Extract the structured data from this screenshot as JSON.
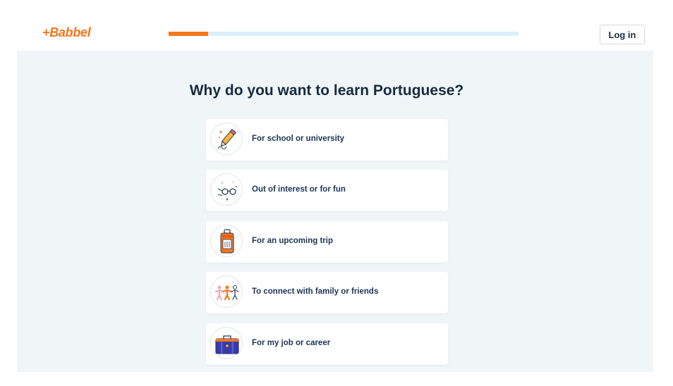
{
  "header": {
    "logo_text": "+Babbel",
    "login_label": "Log in",
    "progress_fraction": 0.113
  },
  "colors": {
    "brand_orange": "#f3761c",
    "progress_track": "#d8eefc",
    "text_dark": "#162b41",
    "panel_bg": "#f0f5f8"
  },
  "main": {
    "question": "Why do you want to learn Portuguese?",
    "options": [
      {
        "label": "For school or university",
        "icon": "pencil-icon"
      },
      {
        "label": "Out of interest or for fun",
        "icon": "glasses-icon"
      },
      {
        "label": "For an upcoming trip",
        "icon": "suitcase-icon"
      },
      {
        "label": "To connect with family or friends",
        "icon": "people-icon"
      },
      {
        "label": "For my job or career",
        "icon": "briefcase-icon"
      }
    ]
  }
}
